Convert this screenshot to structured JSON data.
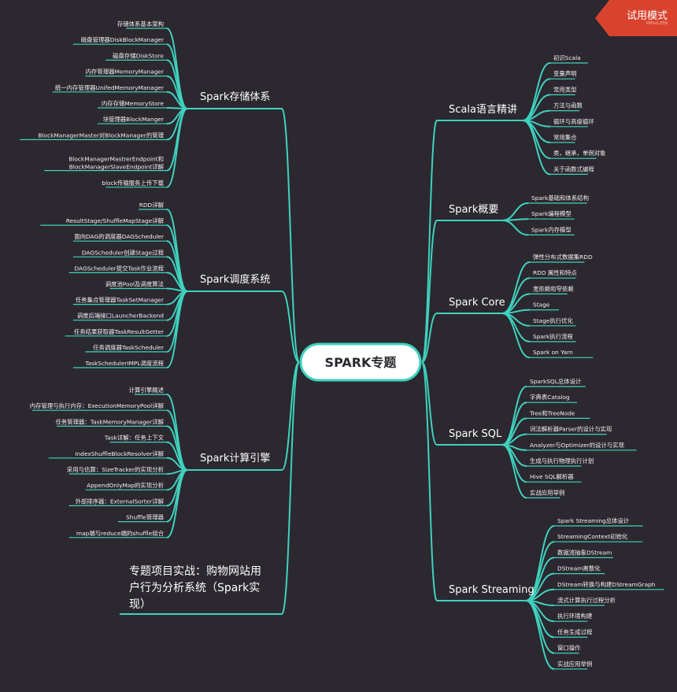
{
  "colors": {
    "background": "#2c2830",
    "line": "#3fd2be",
    "leaf_text": "#f2f2f2",
    "trial_badge": "#d9432e"
  },
  "center": {
    "label": "SPARK专题"
  },
  "trial": {
    "label": "试用模式",
    "sub": "XMind·ZEN"
  },
  "left_branches": [
    {
      "label": "Spark存储体系",
      "children": [
        "存储体系基本架构",
        "磁盘管理器DiskBlockManager",
        "磁盘存储DiskStore",
        "内存管理器MemoryManager",
        "统一内存管理器UnifedMemoryManager",
        "内存存储MemoryStore",
        "块管理器BlockManger",
        "BlockManagerMaster对BlockManager的管理",
        "BlockManagerMastrerEndpoint和\nBlockManagerSlaveEndpoint详解",
        "block传输服务上传下载"
      ]
    },
    {
      "label": "Spark调度系统",
      "children": [
        "RDD详解",
        "ResultStage/ShuffleMapStage详解",
        "面向DAG的调度器DAGScheduler",
        "DAGScheduler创建Stage过程",
        "DAGScheduler提交Task作业流程",
        "调度池Pool及调度算法",
        "任务集合管理器TaskSetManager",
        "调度后端接口LauncherBackend",
        "任务结果获取器TaskResultGetter",
        "任务调度器TaskScheduler",
        "TaskSchedulerIMPL调度流程"
      ]
    },
    {
      "label": "Spark计算引擎",
      "children": [
        "计算引擎概述",
        "内存管理与执行内存：ExecutionMemoryPool详解",
        "任务管理器：TaskMemoryManager详解",
        "Task详解：任务上下文",
        "IndexShuffleBlockResolver详解",
        "采用与估算：SizeTracker的实现分析",
        "AppendOnlyMap的实现分析",
        "外部排序器：ExternalSorter详解",
        "Shuffle管理器",
        "map端与reduce端的shuffle组合"
      ]
    },
    {
      "label": "专题项目实战：购物网站用\n户行为分析系统（Spark实\n现）",
      "children": []
    }
  ],
  "right_branches": [
    {
      "label": "Scala语言精讲",
      "children": [
        "初识Scala",
        "变量声明",
        "常用类型",
        "方法与函数",
        "循环与高级循环",
        "常用集合",
        "类，继承，单例对象",
        "关于函数式编程"
      ]
    },
    {
      "label": "Spark概要",
      "children": [
        "Spark基础和体系结构",
        "Spark编程模型",
        "Spark内存模型"
      ]
    },
    {
      "label": "Spark Core",
      "children": [
        "弹性分布式数据集RDD",
        "RDD 属性和特点",
        "宽依赖和窄依赖",
        "Stage",
        "Stage执行优化",
        "Spark执行流程",
        "Spark on Yarn"
      ]
    },
    {
      "label": "Spark SQL",
      "children": [
        "SparkSQL总体设计",
        "字典表Catalog",
        "Tree和TreeNode",
        "词法解析器Parser的设计与实现",
        "Analyzer与Optimizer的设计与实现",
        "生成与执行物理执行计划",
        "Hive SQL解析器",
        "实战应用举例"
      ]
    },
    {
      "label": "Spark Streaming",
      "children": [
        "Spark Streaming总体设计",
        "StreamingContext初始化",
        "数据流抽象DStream",
        "DStream离散化",
        "DStream转换与构建DStreamGraph",
        "流式计算执行过程分析",
        "执行环境构建",
        "任务生成过程",
        "窗口操作",
        "实战应用举例"
      ]
    }
  ]
}
